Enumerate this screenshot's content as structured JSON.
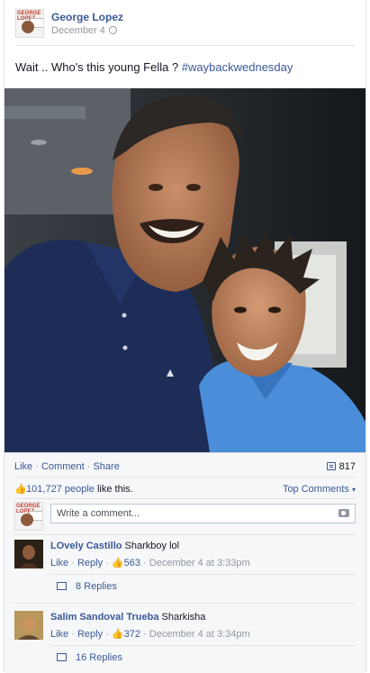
{
  "post": {
    "author": "George Lopez",
    "date": "December 4",
    "message": "Wait .. Who's this young Fella ?",
    "hashtag": "#waybackwednesday"
  },
  "actions": {
    "like": "Like",
    "comment": "Comment",
    "share": "Share",
    "dot": "·",
    "comment_count": "817"
  },
  "likes": {
    "count_text": "101,727 people",
    "suffix": "like this.",
    "sort": "Top Comments"
  },
  "composer": {
    "placeholder": "Write a comment..."
  },
  "comments": [
    {
      "author": "LOvely Castillo",
      "text": "Sharkboy lol",
      "like": "Like",
      "reply": "Reply",
      "likes": "563",
      "time": "December 4 at 3:33pm",
      "replies": "8 Replies"
    },
    {
      "author": "Salim Sandoval Trueba",
      "text": "Sharkisha",
      "like": "Like",
      "reply": "Reply",
      "likes": "372",
      "time": "December 4 at 3:34pm",
      "replies": "16 Replies"
    }
  ],
  "avatar": {
    "logo_line1": "GEORGE LOPEZ"
  },
  "colors": {
    "link": "#3b5998",
    "meta": "#9197a3",
    "shirt": "#1d2d58",
    "shirt_light": "#4a8dd8"
  }
}
